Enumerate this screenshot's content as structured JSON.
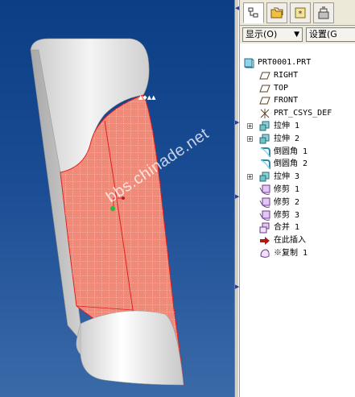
{
  "viewport": {
    "watermark": "bbs.chinade.net",
    "tag_label": "▲◆▲▲"
  },
  "panel": {
    "tabs": [
      {
        "icon": "model-tree-icon"
      },
      {
        "icon": "folder-browser-icon"
      },
      {
        "icon": "favorites-icon"
      },
      {
        "icon": "connections-icon"
      }
    ],
    "show_button": "显示(O)",
    "settings_button": "设置(G",
    "tree": [
      {
        "label": "PRT0001.PRT",
        "icon": "part-icon",
        "expandable": false
      },
      {
        "label": "RIGHT",
        "icon": "datum-plane-icon",
        "expandable": false
      },
      {
        "label": "TOP",
        "icon": "datum-plane-icon",
        "expandable": false
      },
      {
        "label": "FRONT",
        "icon": "datum-plane-icon",
        "expandable": false
      },
      {
        "label": "PRT_CSYS_DEF",
        "icon": "csys-icon",
        "expandable": false
      },
      {
        "label": "拉伸 1",
        "icon": "extrude-icon",
        "expandable": true
      },
      {
        "label": "拉伸 2",
        "icon": "extrude-icon",
        "expandable": true
      },
      {
        "label": "倒圆角 1",
        "icon": "round-icon",
        "expandable": false
      },
      {
        "label": "倒圆角 2",
        "icon": "round-icon",
        "expandable": false
      },
      {
        "label": "拉伸 3",
        "icon": "extrude-icon",
        "expandable": true
      },
      {
        "label": "修剪 1",
        "icon": "trim-icon",
        "expandable": false
      },
      {
        "label": "修剪 2",
        "icon": "trim-icon",
        "expandable": false
      },
      {
        "label": "修剪 3",
        "icon": "trim-icon",
        "expandable": false
      },
      {
        "label": "合并 1",
        "icon": "merge-icon",
        "expandable": false
      },
      {
        "label": "在此插入",
        "icon": "insert-here-arrow-icon",
        "expandable": false
      },
      {
        "label": "※复制 1",
        "icon": "copy-surface-icon",
        "expandable": false
      }
    ]
  },
  "colors": {
    "viewport_top": "#0c3e86",
    "surface_red": "#f08070",
    "edge_red": "#e02020",
    "body_gray": "#d8d8d8"
  }
}
